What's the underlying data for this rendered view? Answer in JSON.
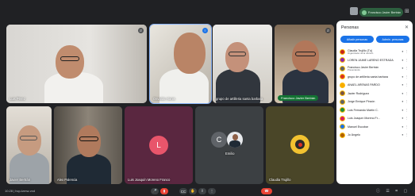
{
  "top_bar": {
    "presenter_label": "Francisco Javier Bertrán",
    "icons": [
      "present-icon",
      "settings-icon",
      "grid-icon"
    ]
  },
  "tiles": [
    {
      "name": "Luis Pérez"
    },
    {
      "name": "Osvaldo Alanis"
    },
    {
      "name": "grupo de artilleria santa barbara"
    },
    {
      "name": "Francisco Javier Bertrán"
    },
    {
      "name": "Javier Bertrán"
    },
    {
      "name": "Alex Palencia"
    },
    {
      "name": "Luis Joaquín Moreno Franco",
      "initial": "L"
    },
    {
      "name": "Emilio",
      "initial": "C"
    },
    {
      "name": "Claudia Trujillo"
    }
  ],
  "people_panel": {
    "title": "Personas",
    "add_button": "Añadir personas",
    "host_button": "Admin. personas",
    "participants": [
      {
        "name": "Claudia Trujillo (Tú)",
        "sub": "Organizador de la reunión",
        "color": "#c5221f"
      },
      {
        "name": "LOREN JAIME LARENO ESTRADA",
        "sub": "",
        "color": "#8e24aa"
      },
      {
        "name": "Francisco Javier Bertrán",
        "sub": "Presentando",
        "color": "#5f6368"
      },
      {
        "name": "grupo de artilleria santa barbara",
        "sub": "",
        "color": "#d93025"
      },
      {
        "name": "ANAEL ARENAS PARDO",
        "sub": "",
        "color": "#f9ab00"
      },
      {
        "name": "Javier Rodríguez",
        "sub": "",
        "color": "#795548"
      },
      {
        "name": "Jorge Enrique Pinzón",
        "sub": "",
        "color": "#5f6368"
      },
      {
        "name": "Luis Fernando Martín C.",
        "sub": "",
        "color": "#1e8e3e"
      },
      {
        "name": "Luis Joaquín Moreno Fr...",
        "sub": "",
        "color": "#d81b60"
      },
      {
        "name": "Manuel Escobar",
        "sub": "",
        "color": "#1a73e8"
      },
      {
        "name": "Jo Ángelo",
        "sub": "",
        "color": "#b06000"
      }
    ]
  },
  "bottom_bar": {
    "meeting_info": "10:28 | hcp-tzmw-vxd",
    "controls": [
      "mic-icon",
      "camera-icon",
      "captions-icon",
      "raise-hand-icon",
      "present-icon",
      "more-icon",
      "leave-call-icon"
    ],
    "right_icons": "ⓘ ☰ ⌗ ▢"
  }
}
